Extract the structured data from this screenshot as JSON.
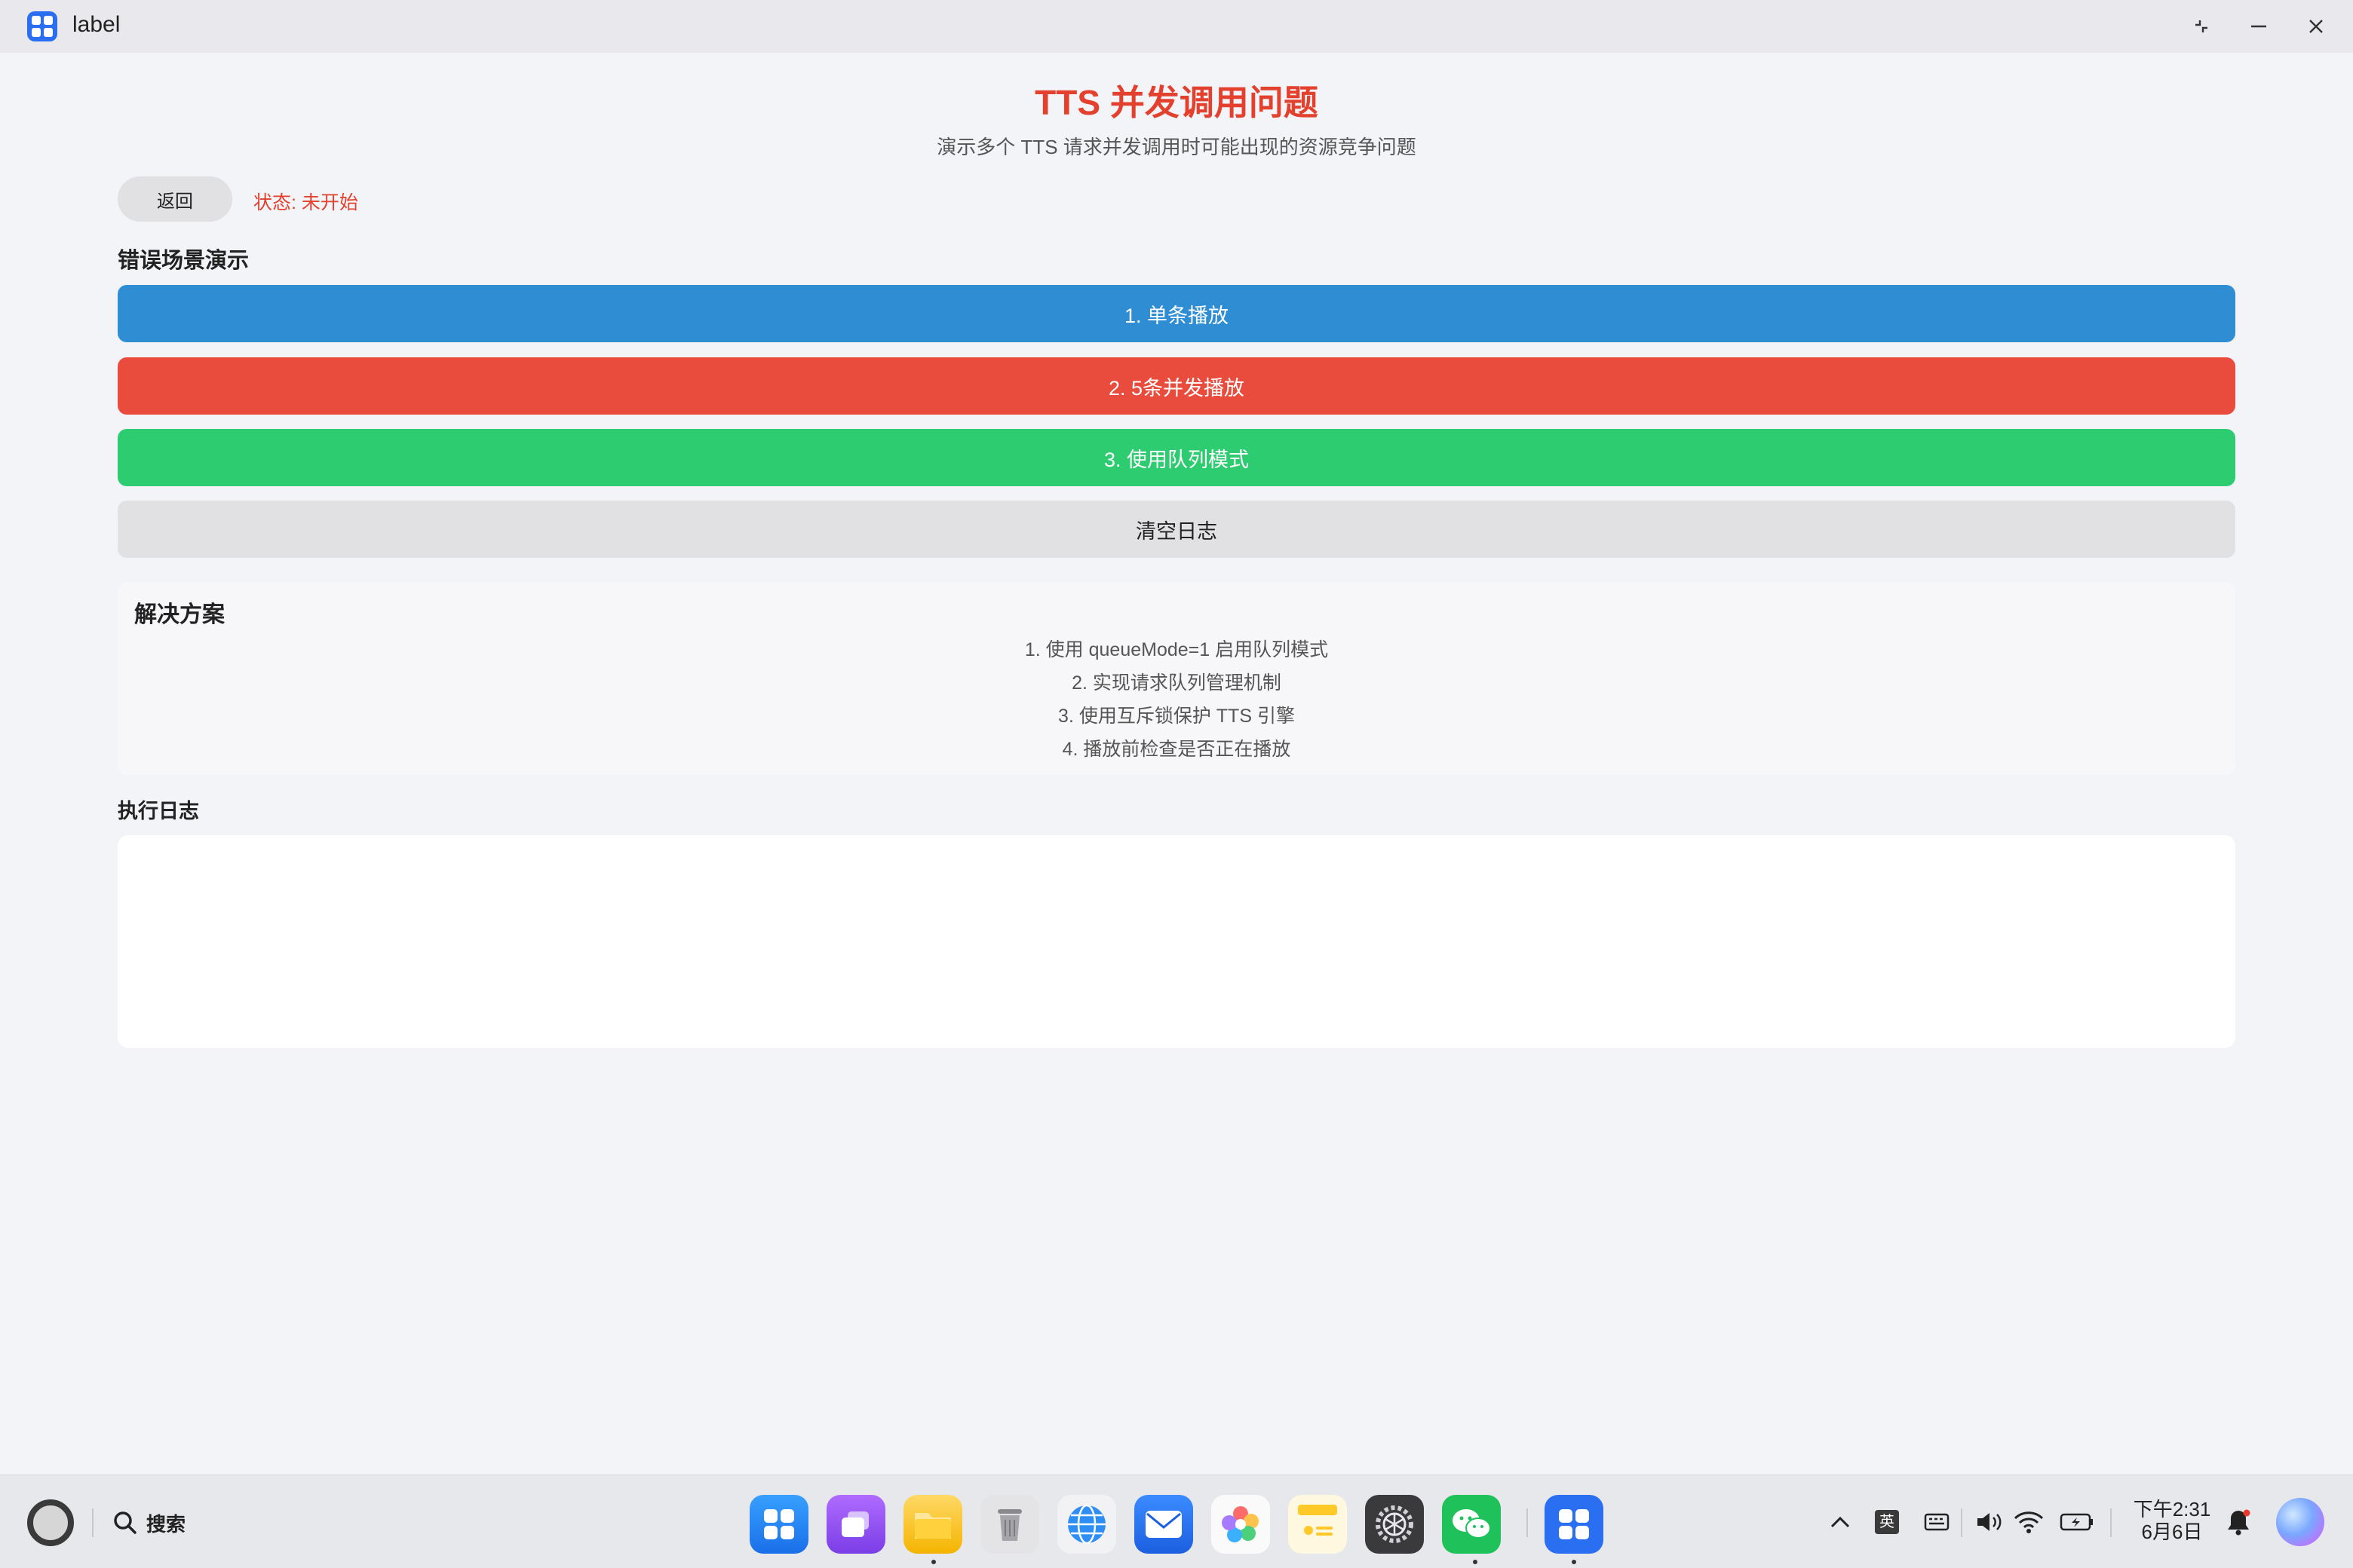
{
  "window": {
    "title": "label"
  },
  "header": {
    "title": "TTS 并发调用问题",
    "subtitle": "演示多个 TTS 请求并发调用时可能出现的资源竞争问题"
  },
  "controls": {
    "back_label": "返回",
    "status_text": "状态: 未开始"
  },
  "scenario": {
    "title": "错误场景演示",
    "buttons": [
      {
        "label": "1. 单条播放",
        "color": "#2f8ed3"
      },
      {
        "label": "2. 5条并发播放",
        "color": "#e94c3d"
      },
      {
        "label": "3. 使用队列模式",
        "color": "#2ecc71"
      },
      {
        "label": "清空日志",
        "color": "#e1e1e4"
      }
    ]
  },
  "solution": {
    "title": "解决方案",
    "items": [
      "1. 使用 queueMode=1 启用队列模式",
      "2. 实现请求队列管理机制",
      "3. 使用互斥锁保护 TTS 引擎",
      "4. 播放前检查是否正在播放"
    ]
  },
  "log": {
    "title": "执行日志",
    "content": ""
  },
  "taskbar": {
    "search_label": "搜索",
    "apps": [
      "app-center",
      "multitask",
      "files",
      "trash",
      "browser",
      "mail",
      "gallery",
      "notes",
      "settings",
      "wechat",
      "label-app"
    ],
    "ime_label": "英",
    "time": "下午2:31",
    "date": "6月6日"
  }
}
